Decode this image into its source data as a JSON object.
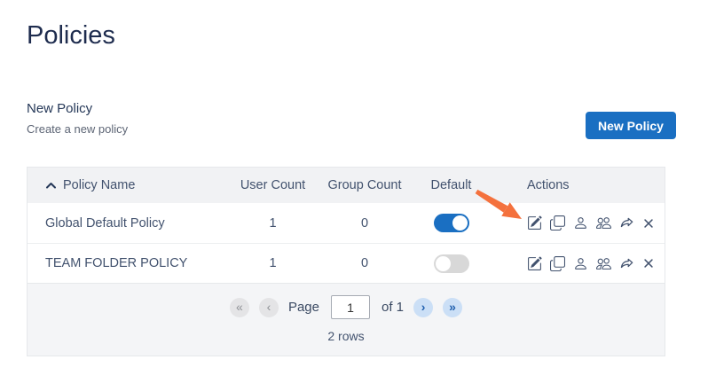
{
  "page": {
    "title": "Policies"
  },
  "section": {
    "title": "New Policy",
    "subtitle": "Create a new policy"
  },
  "toolbar": {
    "new_policy_label": "New Policy"
  },
  "table": {
    "columns": {
      "policy_name": "Policy Name",
      "user_count": "User Count",
      "group_count": "Group Count",
      "default": "Default",
      "actions": "Actions"
    },
    "rows": [
      {
        "name": "Global Default Policy",
        "user_count": "1",
        "group_count": "0",
        "default": true
      },
      {
        "name": "TEAM FOLDER POLICY",
        "user_count": "1",
        "group_count": "0",
        "default": false
      }
    ],
    "action_icons": [
      "edit",
      "copy",
      "assign-user",
      "assign-group",
      "export",
      "delete"
    ]
  },
  "pagination": {
    "first_icon": "«",
    "prev_icon": "‹",
    "page_label": "Page",
    "current_page": "1",
    "of_text": "of 1",
    "next_icon": "›",
    "last_icon": "»",
    "rows_text": "2 rows"
  },
  "colors": {
    "accent_blue": "#1a6fc2",
    "title_navy": "#1e2c4e",
    "table_text": "#42526e",
    "header_bg": "#f1f2f4",
    "footer_bg": "#f4f5f7",
    "toggle_off": "#d8d8d8",
    "annotation_arrow_orange": "#f4713d"
  }
}
